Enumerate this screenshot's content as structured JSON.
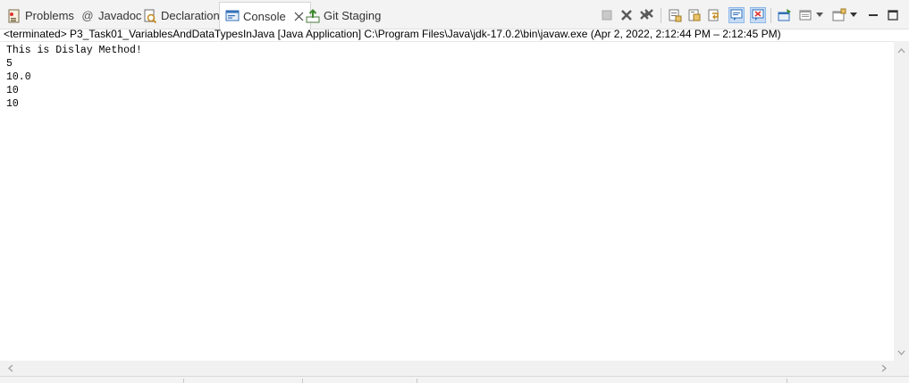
{
  "tabs": [
    {
      "label": "Problems",
      "icon": "problems-icon"
    },
    {
      "label": "Javadoc",
      "icon": "at-icon"
    },
    {
      "label": "Declaration",
      "icon": "declaration-icon"
    },
    {
      "label": "Console",
      "icon": "console-icon",
      "active": true
    },
    {
      "label": "Git Staging",
      "icon": "git-staging-icon"
    }
  ],
  "toolbar": {
    "icons": [
      "terminate-icon",
      "remove-launch-icon",
      "remove-all-terminated-icon",
      "clear-console-icon",
      "scroll-lock-icon",
      "word-wrap-icon",
      "show-console-on-stdout-icon",
      "show-console-on-stderr-icon",
      "pin-console-icon",
      "display-selected-console-icon",
      "open-console-icon",
      "minimize-icon",
      "maximize-icon"
    ]
  },
  "launch_info": "<terminated> P3_Task01_VariablesAndDataTypesInJava [Java Application] C:\\Program Files\\Java\\jdk-17.0.2\\bin\\javaw.exe  (Apr 2, 2022, 2:12:44 PM – 2:12:45 PM)",
  "console_output": "This is Dislay Method!\n5\n10.0\n10\n10",
  "colors": {
    "accent": "#2f6fba",
    "pressed_bg": "#c6dcf5"
  }
}
